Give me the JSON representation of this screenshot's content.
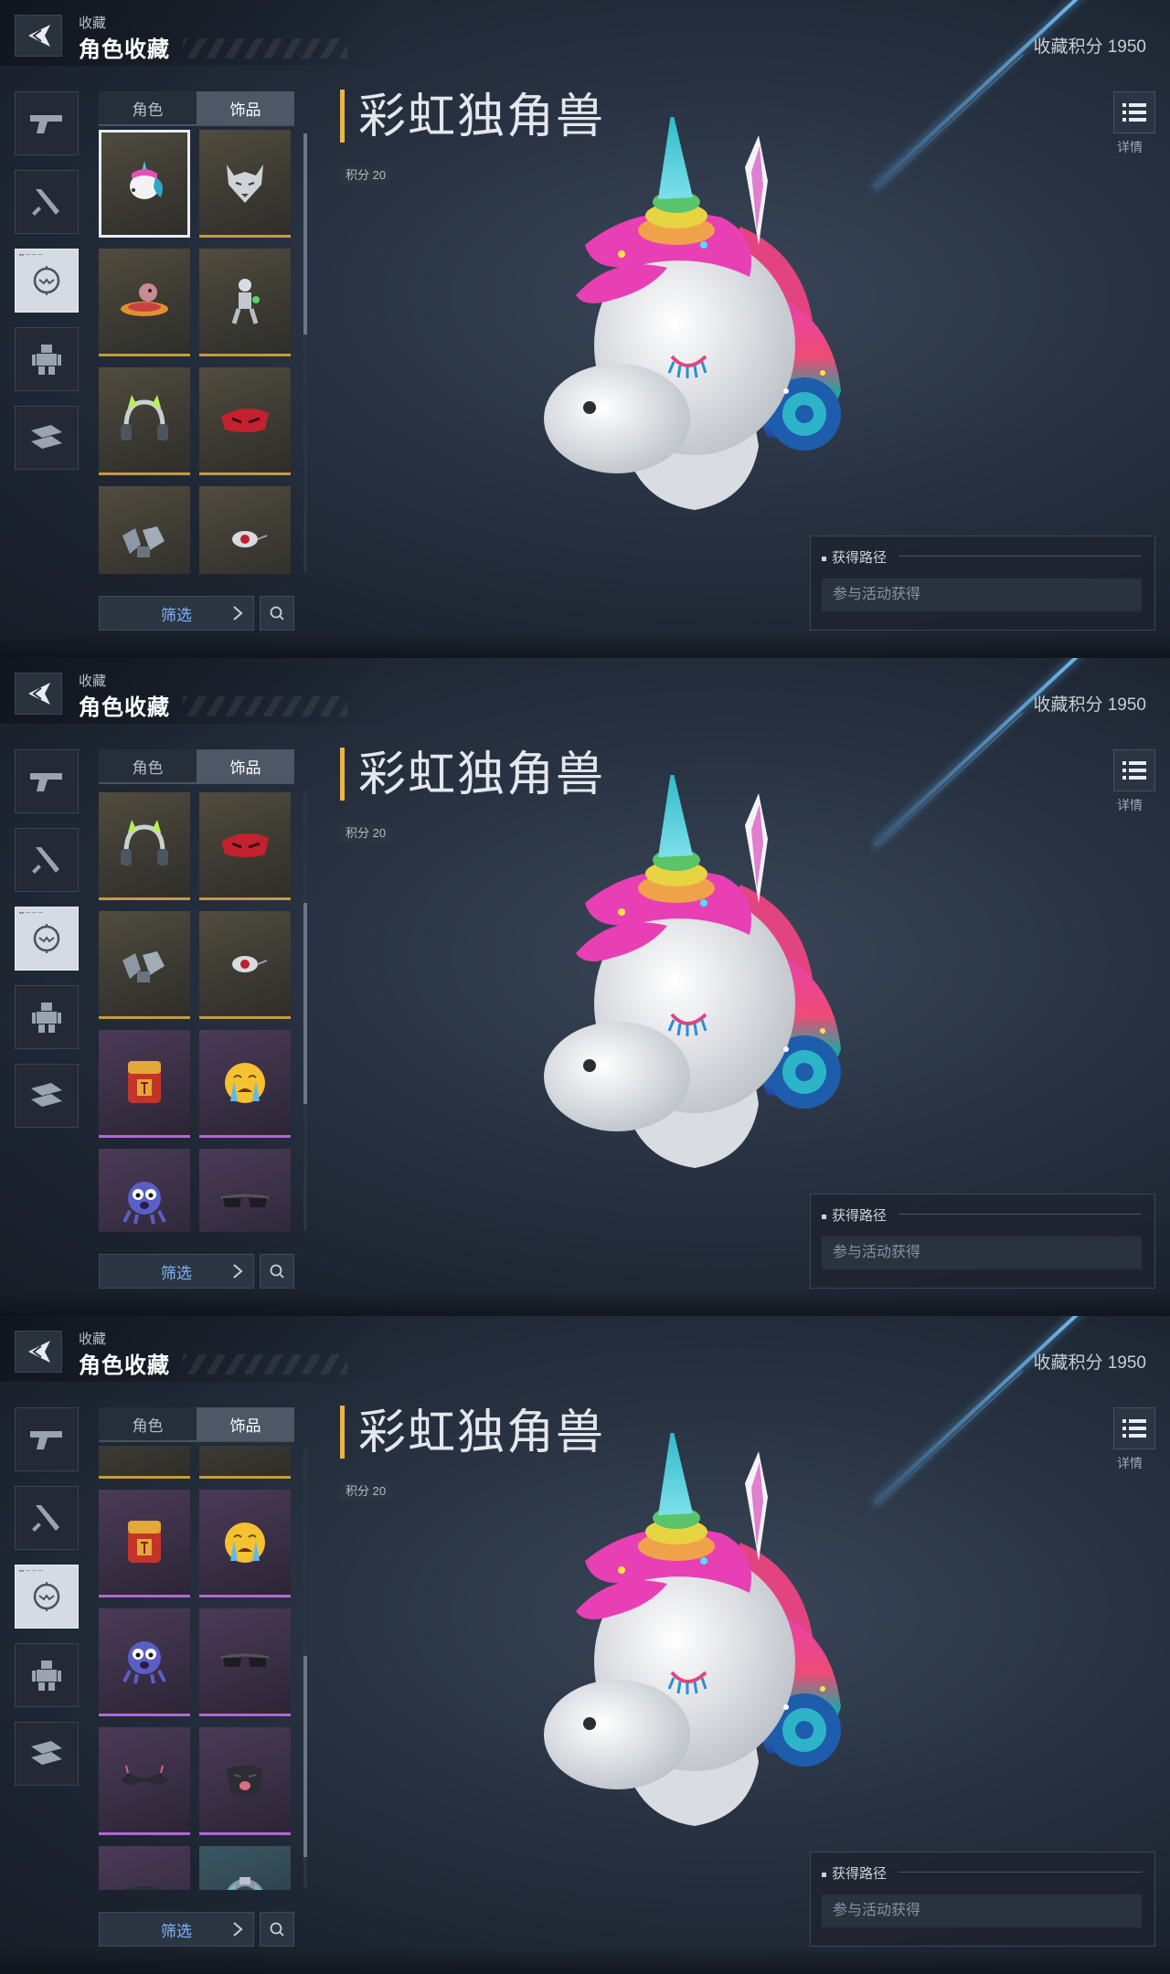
{
  "header": {
    "subtitle": "收藏",
    "title": "角色收藏",
    "points_label": "收藏积分 1950"
  },
  "detail": {
    "label": "详情"
  },
  "tabs": [
    "角色",
    "饰品"
  ],
  "active_tab": "饰品",
  "categories": [
    "gun-icon",
    "melee-icon",
    "head-icon",
    "robot-icon",
    "vehicle-icon"
  ],
  "item": {
    "name": "彩虹独角兽",
    "points": "积分 20"
  },
  "acquisition": {
    "title": "获得路径",
    "method": "参与活动获得"
  },
  "list": {
    "filter_label": "筛选"
  },
  "item_grid": [
    {
      "icon": "unicorn-head",
      "rarity": "gold",
      "selected": true
    },
    {
      "icon": "wolf-head",
      "rarity": "gold"
    },
    {
      "icon": "ufo-creature",
      "rarity": "gold"
    },
    {
      "icon": "robot-figure",
      "rarity": "gold"
    },
    {
      "icon": "cat-ear-headphones",
      "rarity": "gold"
    },
    {
      "icon": "red-visor",
      "rarity": "gold"
    },
    {
      "icon": "armor-pieces",
      "rarity": "gold"
    },
    {
      "icon": "red-eye-drone",
      "rarity": "gold"
    },
    {
      "icon": "treasure-backpack",
      "rarity": "purple"
    },
    {
      "icon": "crying-emoji",
      "rarity": "purple"
    },
    {
      "icon": "purple-critter",
      "rarity": "purple"
    },
    {
      "icon": "dark-sunglasses",
      "rarity": "purple"
    },
    {
      "icon": "spiked-glasses",
      "rarity": "purple"
    },
    {
      "icon": "tongue-mask",
      "rarity": "purple"
    },
    {
      "icon": "smile-mask",
      "rarity": "purple"
    },
    {
      "icon": "tech-ring",
      "rarity": "cyan"
    }
  ],
  "scroll_states": [
    0,
    0.47,
    0.87
  ]
}
